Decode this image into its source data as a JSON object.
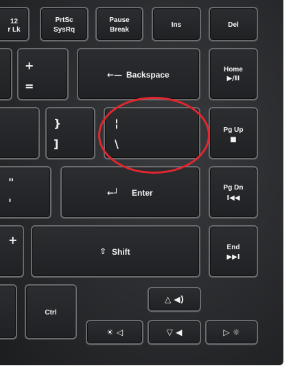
{
  "keys": {
    "f12": {
      "top": "12",
      "bottom": "r Lk"
    },
    "prtsc": {
      "top": "PrtSc",
      "bottom": "SysRq"
    },
    "pause": {
      "top": "Pause",
      "bottom": "Break"
    },
    "ins": {
      "label": "Ins"
    },
    "del": {
      "label": "Del"
    },
    "plus_equal": {
      "top": "+",
      "bottom": "="
    },
    "backspace": {
      "arrow": "←—",
      "label": "Backspace"
    },
    "home": {
      "label": "Home",
      "sub": "▶/II"
    },
    "brace": {
      "top": "}",
      "bottom": "]"
    },
    "pipe": {
      "top": "¦",
      "bottom": "\\"
    },
    "pgup": {
      "label": "Pg Up",
      "sub": "■"
    },
    "quote": {
      "top": "\"",
      "bottom": "'"
    },
    "enter": {
      "arrow": "←┘",
      "label": "Enter"
    },
    "pgdn": {
      "label": "Pg Dn",
      "sub": "I◀◀"
    },
    "plus_left": {
      "top": "+"
    },
    "shift": {
      "arrow": "⇧",
      "label": "Shift"
    },
    "end": {
      "label": "End",
      "sub": "▶▶I"
    },
    "ctrl": {
      "label": "Ctrl"
    },
    "up": {
      "label": "△ ◀)"
    },
    "left": {
      "label": "☀ ◁"
    },
    "down": {
      "label": "▽ ◀"
    },
    "right": {
      "label": "▷ ☼"
    }
  },
  "highlight_color": "#e3262e"
}
